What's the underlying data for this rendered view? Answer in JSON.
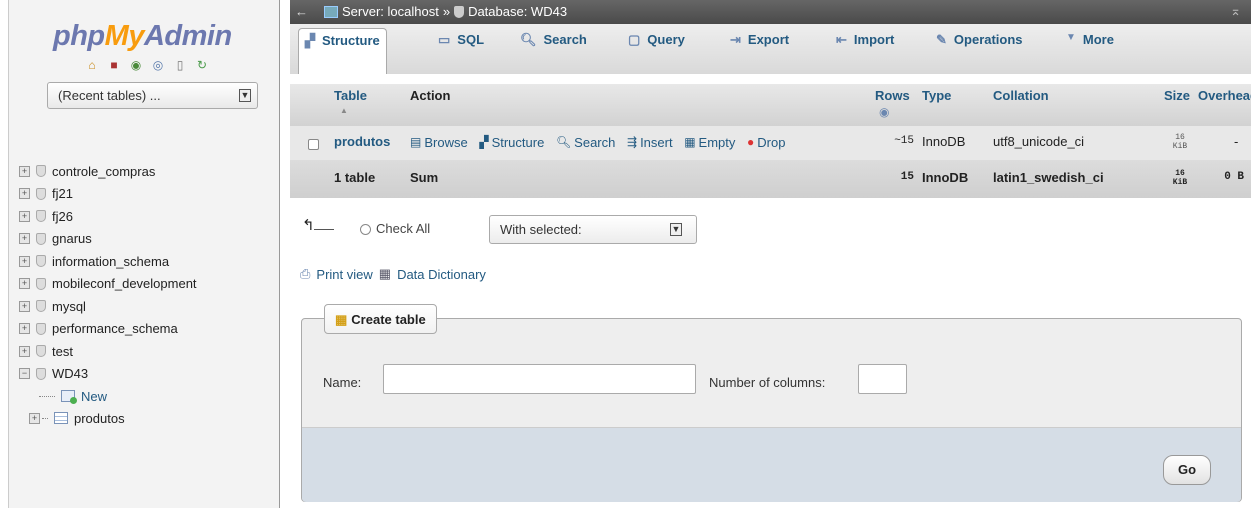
{
  "nav": {
    "logo": {
      "part1": "php",
      "part2": "My",
      "part3": "Admin"
    },
    "icons": [
      "home-icon",
      "exit-icon",
      "query-icon",
      "docs-icon",
      "info-icon",
      "reload-icon"
    ],
    "recent_tables": "(Recent tables) ...",
    "databases": [
      "controle_compras",
      "fj21",
      "fj26",
      "gnarus",
      "information_schema",
      "mobileconf_development",
      "mysql",
      "performance_schema",
      "test",
      "WD43"
    ],
    "wd43_children": {
      "new": "New",
      "table": "produtos"
    }
  },
  "topbar": {
    "server": "Server: localhost",
    "sep": "»",
    "database": "Database: WD43"
  },
  "tabs": [
    {
      "label": "Structure",
      "icon": "structure-icon"
    },
    {
      "label": "SQL",
      "icon": "sql-icon"
    },
    {
      "label": "Search",
      "icon": "search-icon"
    },
    {
      "label": "Query",
      "icon": "query-icon"
    },
    {
      "label": "Export",
      "icon": "export-icon"
    },
    {
      "label": "Import",
      "icon": "import-icon"
    },
    {
      "label": "Operations",
      "icon": "operations-icon"
    },
    {
      "label": "More",
      "icon": "more-icon"
    }
  ],
  "grid": {
    "headers": {
      "table": "Table",
      "action": "Action",
      "rows": "Rows",
      "type": "Type",
      "collation": "Collation",
      "size": "Size",
      "overhead": "Overhead"
    },
    "row": {
      "name": "produtos",
      "actions": [
        "Browse",
        "Structure",
        "Search",
        "Insert",
        "Empty",
        "Drop"
      ],
      "rows": "~15",
      "type": "InnoDB",
      "collation": "utf8_unicode_ci",
      "size_value": "16",
      "size_unit": "KiB",
      "overhead": "-"
    },
    "sum": {
      "label": "1 table",
      "action": "Sum",
      "rows": "15",
      "type": "InnoDB",
      "collation": "latin1_swedish_ci",
      "size_value": "16",
      "size_unit": "KiB",
      "overhead": "0 B"
    }
  },
  "bulk": {
    "check_all": "Check All",
    "with_selected": "With selected:"
  },
  "links": {
    "print_view": "Print view",
    "data_dictionary": "Data Dictionary"
  },
  "create": {
    "legend": "Create table",
    "name_label": "Name:",
    "name_value": "",
    "columns_label": "Number of columns:",
    "columns_value": "",
    "go": "Go"
  },
  "colors": {
    "link": "#235a81",
    "logo_blue": "#6c78af",
    "logo_orange": "#f89c0e"
  }
}
